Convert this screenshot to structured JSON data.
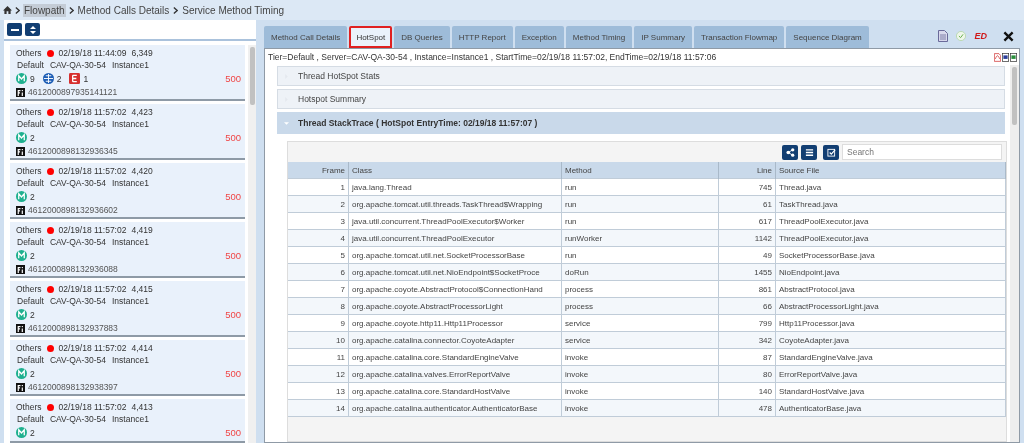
{
  "breadcrumb": [
    {
      "label": "Flowpath",
      "selected": true
    },
    {
      "label": "Method Calls Details",
      "selected": false
    },
    {
      "label": "Service Method Timing",
      "selected": false
    }
  ],
  "flowpaths": [
    {
      "category": "Others",
      "color": "#ff0000",
      "time": "02/19/18 11:44:09",
      "value": "6,349",
      "tier": "Default",
      "server": "CAV-QA-30-54",
      "instance": "Instance1",
      "counters": [
        {
          "kind": "method",
          "count": "9"
        },
        {
          "kind": "http",
          "count": "2"
        },
        {
          "kind": "error",
          "count": "1"
        }
      ],
      "status": "500",
      "id": "4612000897935141121"
    },
    {
      "category": "Others",
      "color": "#ff0000",
      "time": "02/19/18 11:57:02",
      "value": "4,423",
      "tier": "Default",
      "server": "CAV-QA-30-54",
      "instance": "Instance1",
      "counters": [
        {
          "kind": "method",
          "count": "2"
        }
      ],
      "status": "500",
      "id": "4612000898132936345"
    },
    {
      "category": "Others",
      "color": "#ff0000",
      "time": "02/19/18 11:57:02",
      "value": "4,420",
      "tier": "Default",
      "server": "CAV-QA-30-54",
      "instance": "Instance1",
      "counters": [
        {
          "kind": "method",
          "count": "2"
        }
      ],
      "status": "500",
      "id": "4612000898132936602"
    },
    {
      "category": "Others",
      "color": "#ff0000",
      "time": "02/19/18 11:57:02",
      "value": "4,419",
      "tier": "Default",
      "server": "CAV-QA-30-54",
      "instance": "Instance1",
      "counters": [
        {
          "kind": "method",
          "count": "2"
        }
      ],
      "status": "500",
      "id": "4612000898132936088"
    },
    {
      "category": "Others",
      "color": "#ff0000",
      "time": "02/19/18 11:57:02",
      "value": "4,415",
      "tier": "Default",
      "server": "CAV-QA-30-54",
      "instance": "Instance1",
      "counters": [
        {
          "kind": "method",
          "count": "2"
        }
      ],
      "status": "500",
      "id": "4612000898132937883"
    },
    {
      "category": "Others",
      "color": "#ff0000",
      "time": "02/19/18 11:57:02",
      "value": "4,414",
      "tier": "Default",
      "server": "CAV-QA-30-54",
      "instance": "Instance1",
      "counters": [
        {
          "kind": "method",
          "count": "2"
        }
      ],
      "status": "500",
      "id": "4612000898132938397"
    },
    {
      "category": "Others",
      "color": "#ff0000",
      "time": "02/19/18 11:57:02",
      "value": "4,413",
      "tier": "Default",
      "server": "CAV-QA-30-54",
      "instance": "Instance1",
      "counters": [
        {
          "kind": "method",
          "count": "2"
        }
      ],
      "status": "500"
    }
  ],
  "tabs": [
    {
      "label": "Method Call Details",
      "selected": false
    },
    {
      "label": "HotSpot",
      "selected": true
    },
    {
      "label": "DB Queries",
      "selected": false
    },
    {
      "label": "HTTP Report",
      "selected": false
    },
    {
      "label": "Exception",
      "selected": false
    },
    {
      "label": "Method Timing",
      "selected": false
    },
    {
      "label": "IP Summary",
      "selected": false
    },
    {
      "label": "Transaction Flowmap",
      "selected": false
    },
    {
      "label": "Sequence Diagram",
      "selected": false
    }
  ],
  "header_badge": "ED",
  "info": "Tier=Default , Server=CAV-QA-30-54 , Instance=Instance1 , StartTime=02/19/18 11:57:02, EndTime=02/19/18 11:57:06",
  "sections": [
    {
      "title": "Thread HotSpot Stats",
      "expanded": false
    },
    {
      "title": "Hotspot Summary",
      "expanded": false
    },
    {
      "title": "Thread StackTrace ( HotSpot EntryTime: 02/19/18 11:57:07 )",
      "expanded": true
    }
  ],
  "search": {
    "placeholder": "Search"
  },
  "table": {
    "columns": [
      "Frame",
      "Class",
      "Method",
      "Line",
      "Source File"
    ],
    "rows": [
      [
        "1",
        "java.lang.Thread",
        "run",
        "745",
        "Thread.java"
      ],
      [
        "2",
        "org.apache.tomcat.util.threads.TaskThread$Wrapping",
        "run",
        "61",
        "TaskThread.java"
      ],
      [
        "3",
        "java.util.concurrent.ThreadPoolExecutor$Worker",
        "run",
        "617",
        "ThreadPoolExecutor.java"
      ],
      [
        "4",
        "java.util.concurrent.ThreadPoolExecutor",
        "runWorker",
        "1142",
        "ThreadPoolExecutor.java"
      ],
      [
        "5",
        "org.apache.tomcat.util.net.SocketProcessorBase",
        "run",
        "49",
        "SocketProcessorBase.java"
      ],
      [
        "6",
        "org.apache.tomcat.util.net.NioEndpoint$SocketProce",
        "doRun",
        "1455",
        "NioEndpoint.java"
      ],
      [
        "7",
        "org.apache.coyote.AbstractProtocol$ConnectionHand",
        "process",
        "861",
        "AbstractProtocol.java"
      ],
      [
        "8",
        "org.apache.coyote.AbstractProcessorLight",
        "process",
        "66",
        "AbstractProcessorLight.java"
      ],
      [
        "9",
        "org.apache.coyote.http11.Http11Processor",
        "service",
        "799",
        "Http11Processor.java"
      ],
      [
        "10",
        "org.apache.catalina.connector.CoyoteAdapter",
        "service",
        "342",
        "CoyoteAdapter.java"
      ],
      [
        "11",
        "org.apache.catalina.core.StandardEngineValve",
        "invoke",
        "87",
        "StandardEngineValve.java"
      ],
      [
        "12",
        "org.apache.catalina.valves.ErrorReportValve",
        "invoke",
        "80",
        "ErrorReportValve.java"
      ],
      [
        "13",
        "org.apache.catalina.core.StandardHostValve",
        "invoke",
        "140",
        "StandardHostValve.java"
      ],
      [
        "14",
        "org.apache.catalina.authenticator.AuthenticatorBase",
        "invoke",
        "478",
        "AuthenticatorBase.java"
      ]
    ]
  }
}
